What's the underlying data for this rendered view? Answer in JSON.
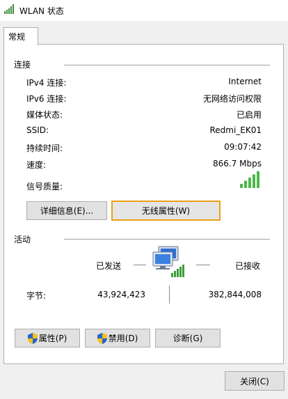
{
  "window": {
    "title": "WLAN 状态",
    "icon": "wifi-signal-icon"
  },
  "tabs": [
    {
      "label": "常规"
    }
  ],
  "connection": {
    "heading": "连接",
    "rows": [
      {
        "label": "IPv4 连接:",
        "value": "Internet"
      },
      {
        "label": "IPv6 连接:",
        "value": "无网络访问权限"
      },
      {
        "label": "媒体状态:",
        "value": "已启用"
      },
      {
        "label": "SSID:",
        "value": "Redmi_EK01"
      },
      {
        "label": "持续时间:",
        "value": "09:07:42"
      },
      {
        "label": "速度:",
        "value": "866.7 Mbps"
      }
    ],
    "signal_label": "信号质量:",
    "signal_bars": 5,
    "signal_color": "#4ab84a",
    "details_button": "详细信息(E)...",
    "wireless_props_button": "无线属性(W)"
  },
  "activity": {
    "heading": "活动",
    "sent_label": "已发送",
    "received_label": "已接收",
    "bytes_label": "字节:",
    "bytes_sent": "43,924,423",
    "bytes_received": "382,844,008",
    "network_icon": "network-computer-icon"
  },
  "actions": {
    "properties": "属性(P)",
    "disable": "禁用(D)",
    "diagnose": "诊断(G)"
  },
  "footer": {
    "close": "关闭(C)"
  },
  "colors": {
    "focus_border": "#e8a317",
    "shield_blue": "#2b63c6",
    "shield_yellow": "#f3c21b"
  }
}
